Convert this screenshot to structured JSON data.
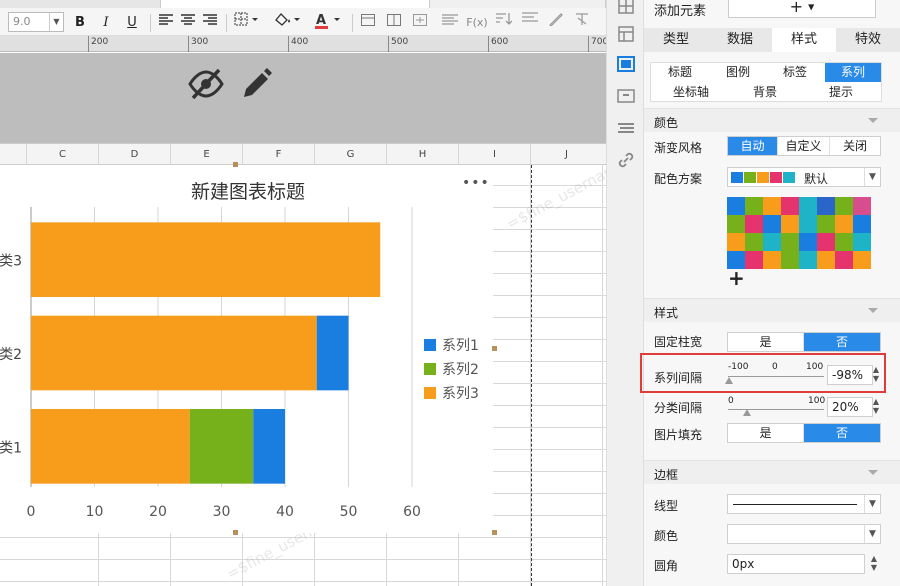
{
  "toolbar": {
    "font_size": "9.0",
    "bold": "B",
    "italic": "I",
    "underline": "U"
  },
  "ruler": {
    "labels": [
      "200",
      "300",
      "400",
      "500",
      "600",
      "700"
    ]
  },
  "sheet": {
    "columns": [
      "C",
      "D",
      "E",
      "F",
      "G",
      "H",
      "I",
      "J"
    ]
  },
  "watermark_text": "=$fine_username",
  "chart_data": {
    "type": "bar",
    "orientation": "horizontal",
    "stacked": true,
    "title": "新建图表标题",
    "categories": [
      "类1",
      "类2",
      "类3"
    ],
    "series": [
      {
        "name": "系列3",
        "color": "#f79c1b",
        "values": [
          25,
          45,
          55
        ]
      },
      {
        "name": "系列2",
        "color": "#76b11b",
        "values": [
          10,
          0,
          0
        ]
      },
      {
        "name": "系列1",
        "color": "#1a7de0",
        "values": [
          5,
          5,
          0
        ]
      }
    ],
    "legend_order": [
      "系列1",
      "系列2",
      "系列3"
    ],
    "xlim": [
      0,
      60
    ],
    "xticks": [
      0,
      10,
      20,
      30,
      40,
      50,
      60
    ],
    "xlabel": "",
    "ylabel": "",
    "grid": true,
    "legend": "right"
  },
  "panel": {
    "add_element_label": "添加元素",
    "add_element_plus": "+",
    "main_tabs": [
      "类型",
      "数据",
      "样式",
      "特效"
    ],
    "sub_tabs_row1": [
      "标题",
      "图例",
      "标签",
      "系列"
    ],
    "sub_tabs_row2": [
      "坐标轴",
      "背景",
      "提示"
    ],
    "color_section": "颜色",
    "gradient_label": "渐变风格",
    "gradient_options": [
      "自动",
      "自定义",
      "关闭"
    ],
    "scheme_label": "配色方案",
    "scheme_value": "默认",
    "scheme_swatches": [
      "#1a7de0",
      "#76b11b",
      "#f79c1b",
      "#e5336d",
      "#1eb3c7"
    ],
    "palette_colors": [
      "#1a7de0",
      "#76b11b",
      "#f79c1b",
      "#e5336d",
      "#1eb3c7",
      "#2a66c8",
      "#76b11b",
      "#d84d8c",
      "#76b11b",
      "#e5336d",
      "#1a7de0",
      "#f79c1b",
      "#1eb3c7",
      "#76b11b",
      "#f79c1b",
      "#1a7de0",
      "#f79c1b",
      "#76b11b",
      "#1eb3c7",
      "#76b11b",
      "#1a7de0",
      "#e5336d",
      "#76b11b",
      "#1eb3c7",
      "#1a7de0",
      "#e5336d",
      "#f79c1b",
      "#76b11b",
      "#1eb3c7",
      "#f79c1b",
      "#e5336d",
      "#f79c1b"
    ],
    "palette_add": "+",
    "style_section": "样式",
    "fixed_width_label": "固定柱宽",
    "yes": "是",
    "no": "否",
    "series_gap_label": "系列间隔",
    "series_gap_scale": [
      "-100",
      "0",
      "100"
    ],
    "series_gap_value": "-98%",
    "series_gap_level": -98,
    "category_gap_label": "分类间隔",
    "category_gap_scale": [
      "0",
      "100"
    ],
    "category_gap_value": "20%",
    "category_gap_level": 20,
    "image_fill_label": "图片填充",
    "border_section": "边框",
    "line_type_label": "线型",
    "border_color_label": "颜色",
    "corner_label": "圆角",
    "corner_value": "0px"
  }
}
